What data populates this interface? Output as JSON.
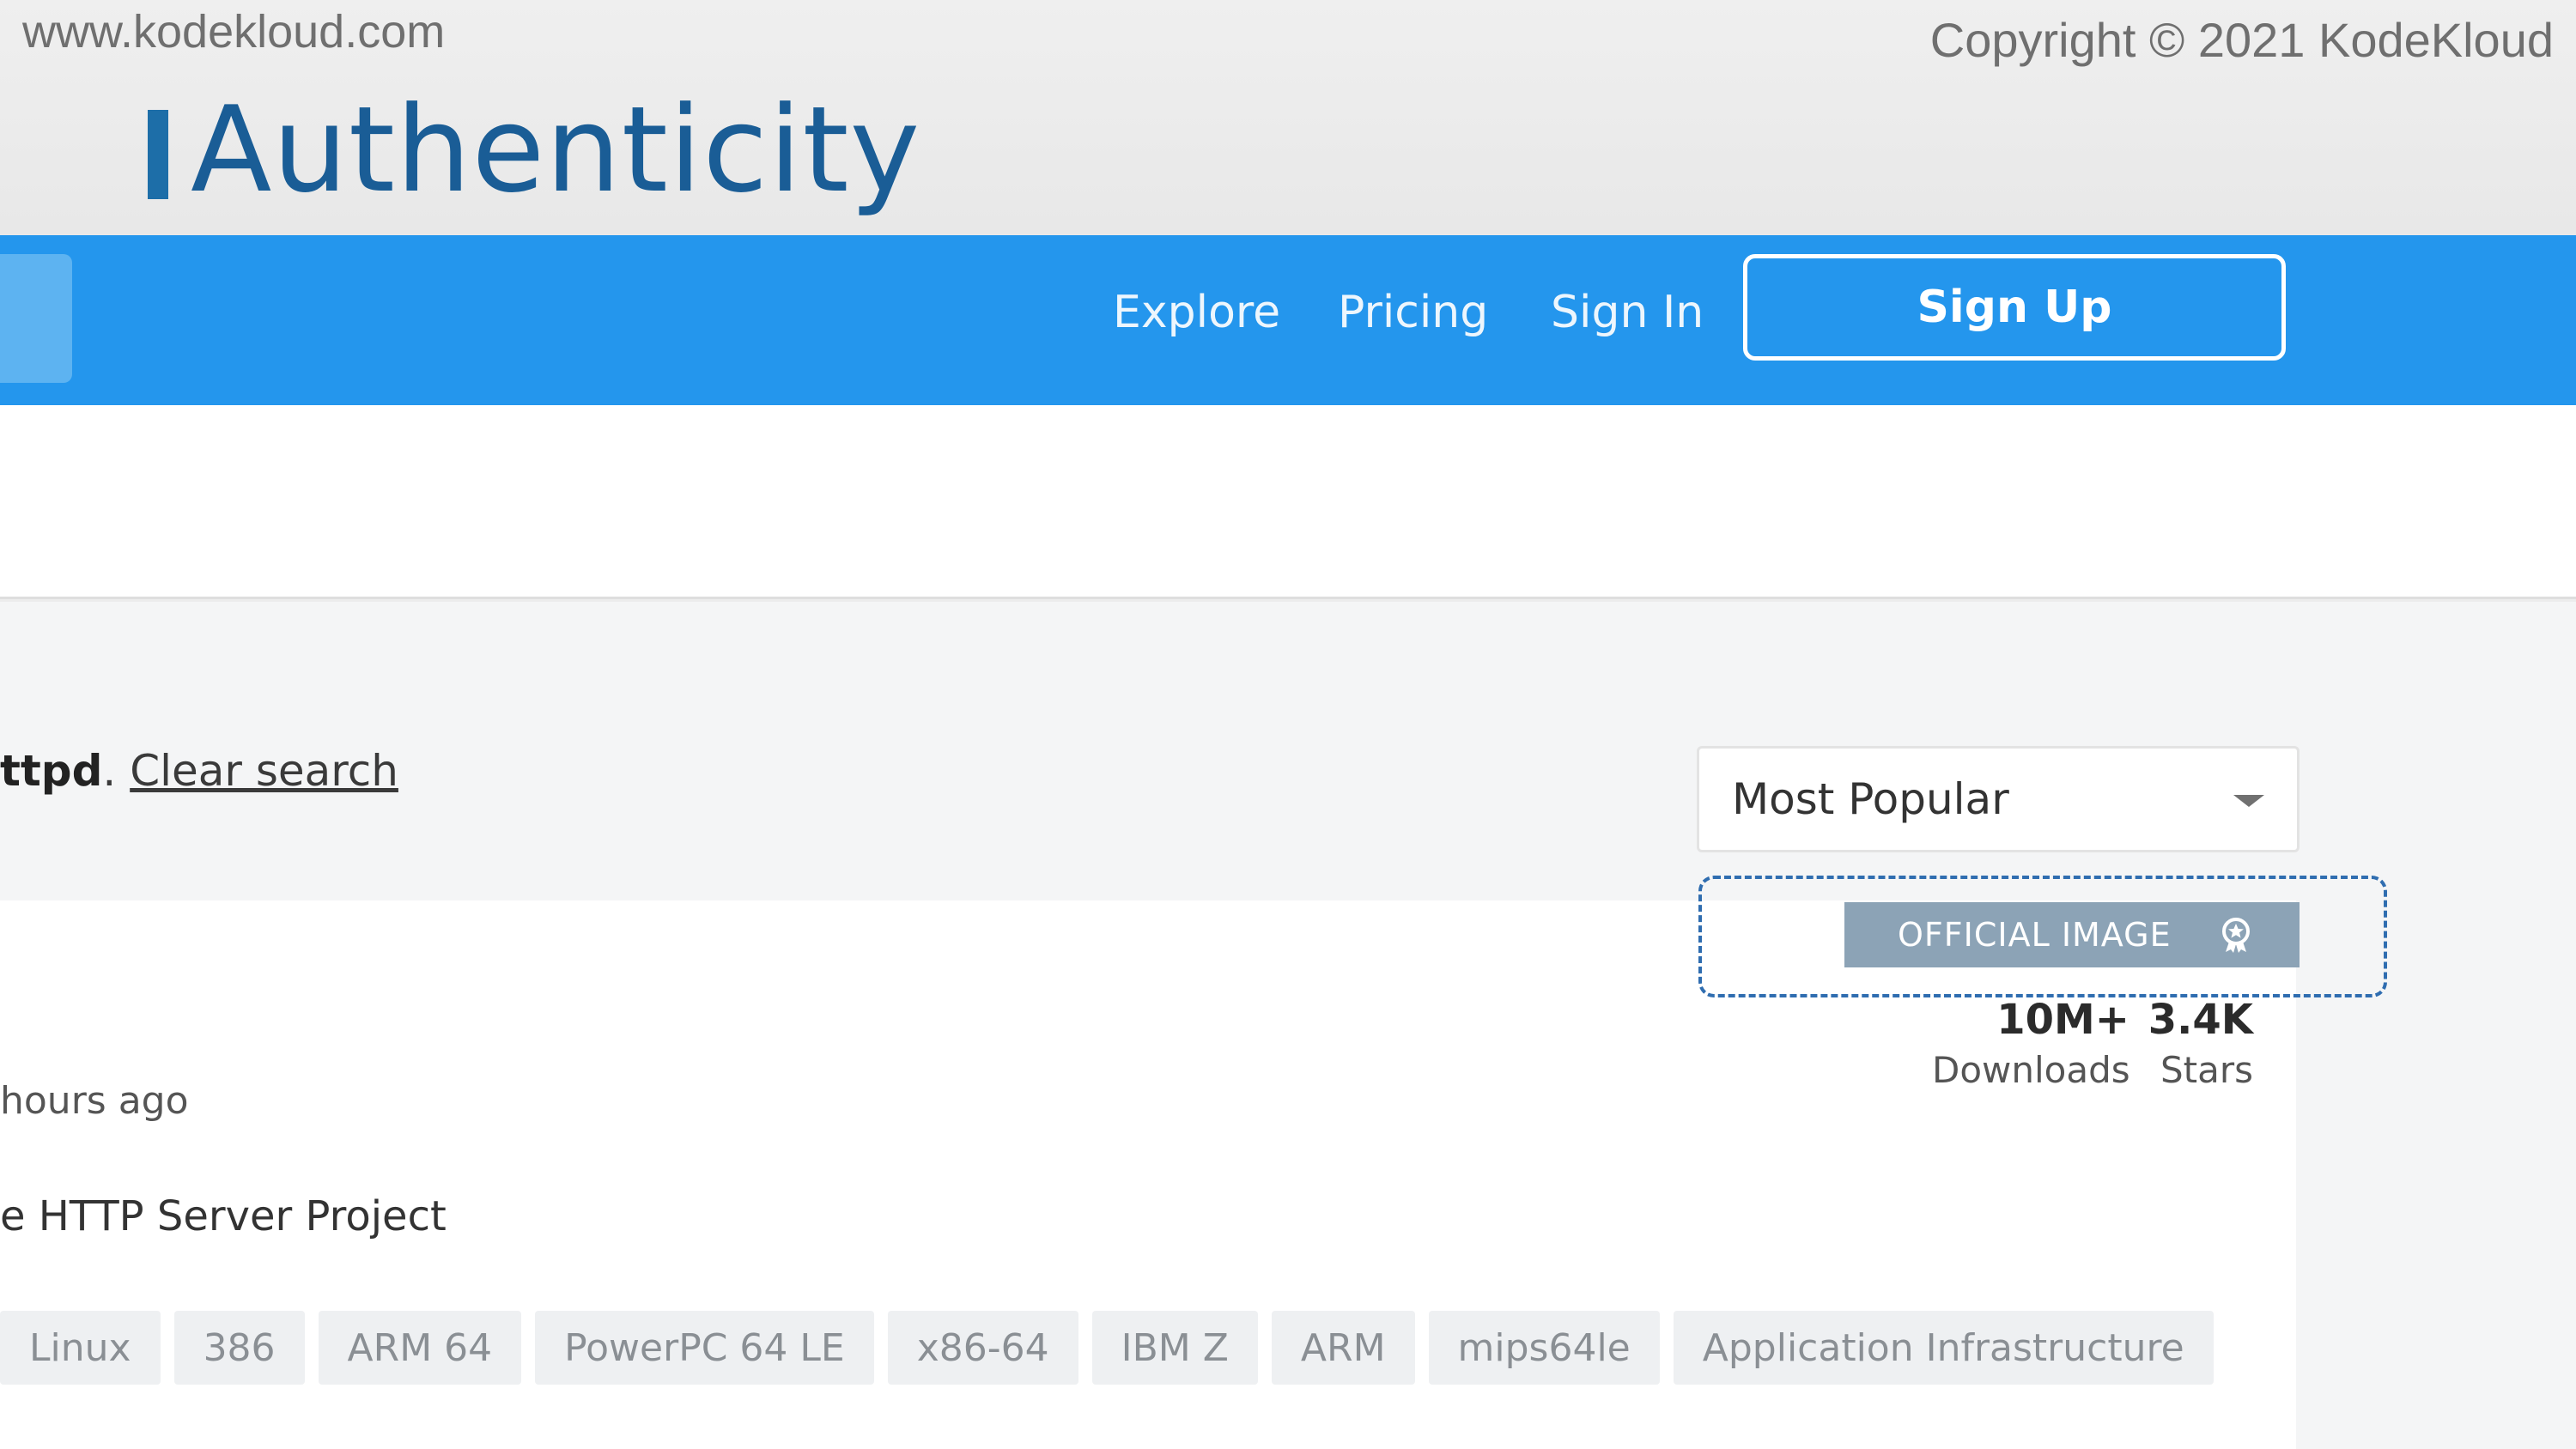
{
  "slide": {
    "site_url": "www.kodekloud.com",
    "copyright": "Copyright © 2021 KodeKloud",
    "title": "Authenticity"
  },
  "navbar": {
    "links": [
      "Explore",
      "Pricing",
      "Sign In"
    ],
    "signup_label": "Sign Up"
  },
  "results": {
    "query_fragment": "ttpd",
    "clear_search_label": "Clear search",
    "sort": {
      "selected": "Most Popular"
    }
  },
  "card": {
    "updated": "hours ago",
    "description": "e HTTP Server Project",
    "badge_label": "OFFICIAL IMAGE",
    "downloads_value": "10M+",
    "downloads_label": "Downloads",
    "stars_value": "3.4K",
    "stars_label": "Stars",
    "tags": [
      "Linux",
      "386",
      "ARM 64",
      "PowerPC 64 LE",
      "x86-64",
      "IBM Z",
      "ARM",
      "mips64le",
      "Application Infrastructure"
    ]
  },
  "colors": {
    "nav_blue": "#2496ed",
    "title_blue": "#1a5d96",
    "badge_gray": "#8ca3b6",
    "highlight_dash": "#2f6db0"
  }
}
